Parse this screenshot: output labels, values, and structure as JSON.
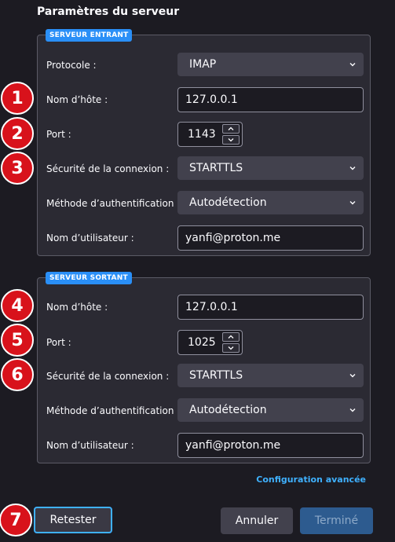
{
  "title": "Paramètres du serveur",
  "incoming": {
    "legend": "SERVEUR ENTRANT",
    "protocol_label": "Protocole :",
    "protocol_value": "IMAP",
    "hostname_label": "Nom d’hôte :",
    "hostname_value": "127.0.0.1",
    "port_label": "Port :",
    "port_value": "1143",
    "security_label": "Sécurité de la connexion :",
    "security_value": "STARTTLS",
    "auth_label": "Méthode d’authentification :",
    "auth_value": "Autodétection",
    "username_label": "Nom d’utilisateur :",
    "username_value": "yanfi@proton.me"
  },
  "outgoing": {
    "legend": "SERVEUR SORTANT",
    "hostname_label": "Nom d’hôte :",
    "hostname_value": "127.0.0.1",
    "port_label": "Port :",
    "port_value": "1025",
    "security_label": "Sécurité de la connexion :",
    "security_value": "STARTTLS",
    "auth_label": "Méthode d’authentification :",
    "auth_value": "Autodétection",
    "username_label": "Nom d’utilisateur :",
    "username_value": "yanfi@proton.me"
  },
  "advanced_link": "Configuration avancée",
  "buttons": {
    "retest": "Retester",
    "cancel": "Annuler",
    "done": "Terminé"
  },
  "markers": [
    "1",
    "2",
    "3",
    "4",
    "5",
    "6",
    "7"
  ],
  "colors": {
    "accent": "#3fb1ff",
    "legend": "#2a8ff7",
    "marker": "#d8121b"
  }
}
